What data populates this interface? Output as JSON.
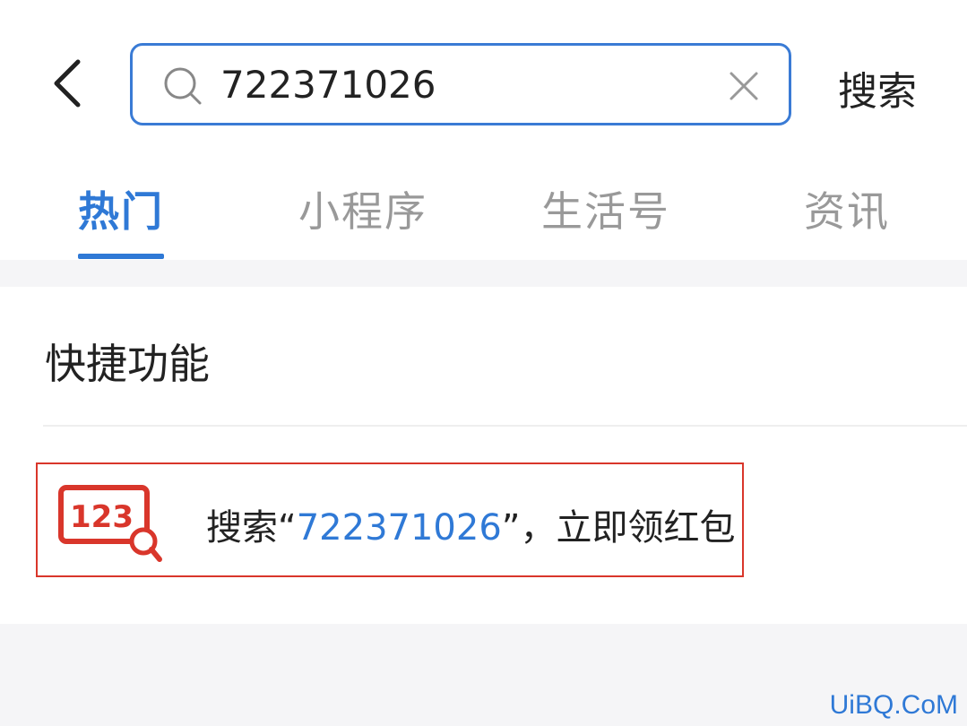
{
  "header": {
    "search_value": "722371026",
    "search_button": "搜索"
  },
  "tabs": [
    {
      "label": "热门",
      "active": true
    },
    {
      "label": "小程序",
      "active": false
    },
    {
      "label": "生活号",
      "active": false
    },
    {
      "label": "资讯",
      "active": false
    }
  ],
  "quick_functions": {
    "title": "快捷功能",
    "item": {
      "icon_text": "123",
      "prefix": "搜索“",
      "keyword": "722371026",
      "suffix": "”，立即领红包"
    }
  },
  "watermark": "UiBQ.CoM",
  "colors": {
    "accent": "#2f79d6",
    "highlight_border": "#d9362b",
    "icon_red": "#d9362b"
  }
}
